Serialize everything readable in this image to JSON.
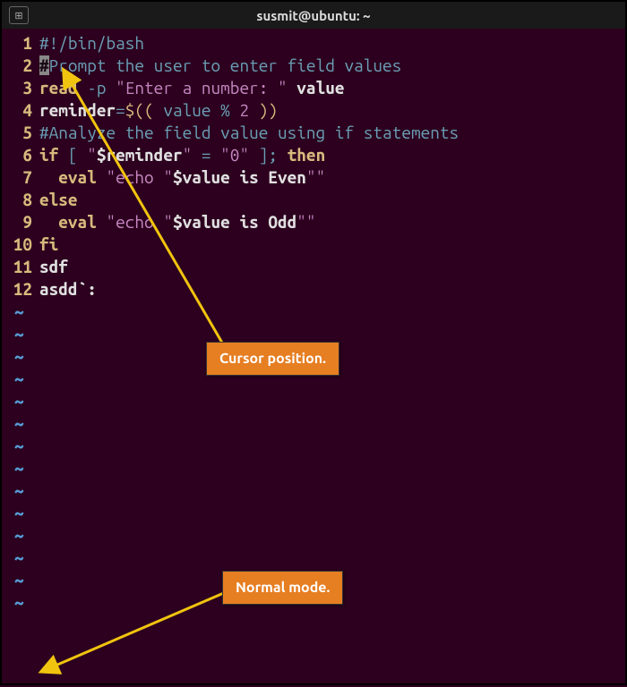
{
  "titlebar": {
    "title": "susmit@ubuntu: ~",
    "tab_icon_glyph": "⊞"
  },
  "editor": {
    "lines": [
      {
        "num": "1",
        "segments": [
          {
            "t": "#!/bin/bash",
            "cls": "c-comment"
          }
        ]
      },
      {
        "num": "2",
        "segments": [
          {
            "t": "#",
            "cls": "cursor-block"
          },
          {
            "t": "Prompt the user to enter field values",
            "cls": "c-comment"
          }
        ]
      },
      {
        "num": "3",
        "segments": [
          {
            "t": "read",
            "cls": "c-key"
          },
          {
            "t": " -p ",
            "cls": "c-comment"
          },
          {
            "t": "\"Enter a number: \"",
            "cls": "c-str"
          },
          {
            "t": " value",
            "cls": "c-plain"
          }
        ]
      },
      {
        "num": "4",
        "segments": [
          {
            "t": "reminder",
            "cls": "c-plain"
          },
          {
            "t": "=",
            "cls": "c-comment"
          },
          {
            "t": "$((",
            "cls": "c-op"
          },
          {
            "t": " value ",
            "cls": "c-comment"
          },
          {
            "t": "%",
            "cls": "c-comment"
          },
          {
            "t": " 2 ",
            "cls": "c-str"
          },
          {
            "t": "))",
            "cls": "c-op"
          }
        ]
      },
      {
        "num": "5",
        "segments": [
          {
            "t": "#Analyze the field value using if statements",
            "cls": "c-comment"
          }
        ]
      },
      {
        "num": "6",
        "segments": [
          {
            "t": "if",
            "cls": "c-key"
          },
          {
            "t": " [ ",
            "cls": "c-comment"
          },
          {
            "t": "\"",
            "cls": "c-str"
          },
          {
            "t": "$reminder",
            "cls": "c-plain"
          },
          {
            "t": "\"",
            "cls": "c-str"
          },
          {
            "t": " = ",
            "cls": "c-comment"
          },
          {
            "t": "\"0\"",
            "cls": "c-str"
          },
          {
            "t": " ]; ",
            "cls": "c-comment"
          },
          {
            "t": "then",
            "cls": "c-key"
          }
        ]
      },
      {
        "num": "7",
        "segments": [
          {
            "t": "  ",
            "cls": "c-comment"
          },
          {
            "t": "eval",
            "cls": "c-key"
          },
          {
            "t": " ",
            "cls": "c-comment"
          },
          {
            "t": "\"echo \"",
            "cls": "c-str"
          },
          {
            "t": "$value",
            "cls": "c-plain"
          },
          {
            "t": " is Even",
            "cls": "c-plain"
          },
          {
            "t": "\"\"",
            "cls": "c-str"
          }
        ]
      },
      {
        "num": "8",
        "segments": [
          {
            "t": "else",
            "cls": "c-key"
          }
        ]
      },
      {
        "num": "9",
        "segments": [
          {
            "t": "  ",
            "cls": "c-comment"
          },
          {
            "t": "eval",
            "cls": "c-key"
          },
          {
            "t": " ",
            "cls": "c-comment"
          },
          {
            "t": "\"echo \"",
            "cls": "c-str"
          },
          {
            "t": "$value",
            "cls": "c-plain"
          },
          {
            "t": " is Odd",
            "cls": "c-plain"
          },
          {
            "t": "\"\"",
            "cls": "c-str"
          }
        ]
      },
      {
        "num": "10",
        "segments": [
          {
            "t": "fi",
            "cls": "c-key"
          }
        ]
      },
      {
        "num": "11",
        "segments": [
          {
            "t": "sdf",
            "cls": "c-plain"
          }
        ]
      },
      {
        "num": "12",
        "segments": [
          {
            "t": "asdd`:",
            "cls": "c-plain"
          }
        ]
      }
    ],
    "tilde_count": 14,
    "tilde_glyph": "~"
  },
  "annotations": {
    "cursor_label": "Cursor position.",
    "mode_label": "Normal mode."
  },
  "arrows": {
    "color": "#f1c40f"
  }
}
